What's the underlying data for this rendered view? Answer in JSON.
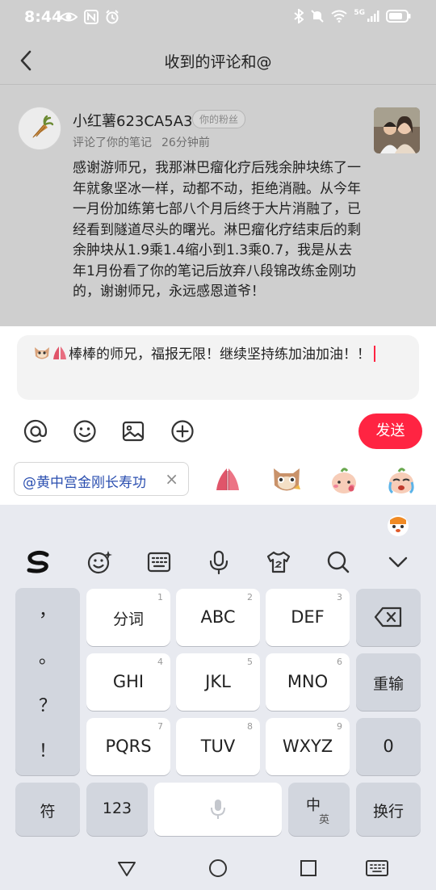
{
  "status_bar": {
    "time": "8:44",
    "signal_label": "5G",
    "battery_level": 0.8
  },
  "header": {
    "title": "收到的评论和@"
  },
  "comment": {
    "user_name": "小红薯623CA5A3",
    "badge": "你的粉丝",
    "action": "评论了你的笔记",
    "time_ago": "26分钟前",
    "text": "感谢游师兄，我那淋巴瘤化疗后残余肿块练了一年就象坚冰一样，动都不动，拒绝消融。从今年一月份加练第七部八个月后终于大片消融了，已经看到隧道尽头的曙光。淋巴瘤化疗结束后的剩余肿块从1.9乘1.4缩小到1.3乘0.7，我是从去年1月份看了你的笔记后放弃八段锦改练金刚功的，谢谢师兄，永远感恩道爷！"
  },
  "reply": {
    "text": "棒棒的师兄，福报无限！继续坚持练加油加油！！",
    "send_label": "发送"
  },
  "mention": {
    "label": "@黄中宫金刚长寿功",
    "close": "×"
  },
  "keyboard": {
    "punctuation": [
      "，",
      "。",
      "？",
      "！"
    ],
    "rows": [
      [
        {
          "label": "分词",
          "num": "1"
        },
        {
          "label": "ABC",
          "num": "2"
        },
        {
          "label": "DEF",
          "num": "3"
        }
      ],
      [
        {
          "label": "GHI",
          "num": "4"
        },
        {
          "label": "JKL",
          "num": "5"
        },
        {
          "label": "MNO",
          "num": "6"
        }
      ],
      [
        {
          "label": "PQRS",
          "num": "7"
        },
        {
          "label": "TUV",
          "num": "8"
        },
        {
          "label": "WXYZ",
          "num": "9"
        }
      ]
    ],
    "retype_label": "重输",
    "zero_label": "0",
    "symbol_label": "符",
    "num_label": "123",
    "lang_main": "中",
    "lang_sub": "英",
    "enter_label": "换行"
  },
  "colors": {
    "accent": "#ff2442",
    "mention": "#2b4fb0",
    "dim": "#cfcfcf"
  }
}
